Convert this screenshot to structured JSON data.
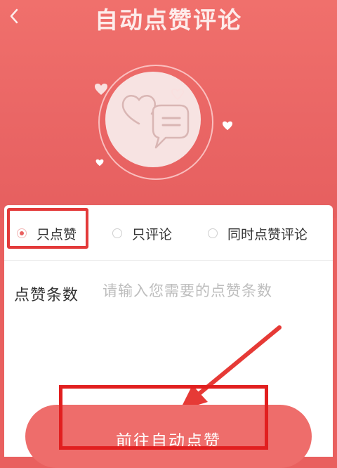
{
  "header": {
    "title": "自动点赞评论",
    "back_icon": "chevron-left-icon",
    "illustration_icon": "chat-hearts-icon"
  },
  "options": [
    {
      "label": "只点赞",
      "selected": true
    },
    {
      "label": "只评论",
      "selected": false
    },
    {
      "label": "同时点赞评论",
      "selected": false
    }
  ],
  "like_count": {
    "label": "点赞条数",
    "value": "",
    "placeholder": "请输入您需要的点赞条数"
  },
  "action": {
    "label": "前往自动点赞"
  },
  "colors": {
    "brand": "#e9605f",
    "highlight": "#e11f1f"
  }
}
